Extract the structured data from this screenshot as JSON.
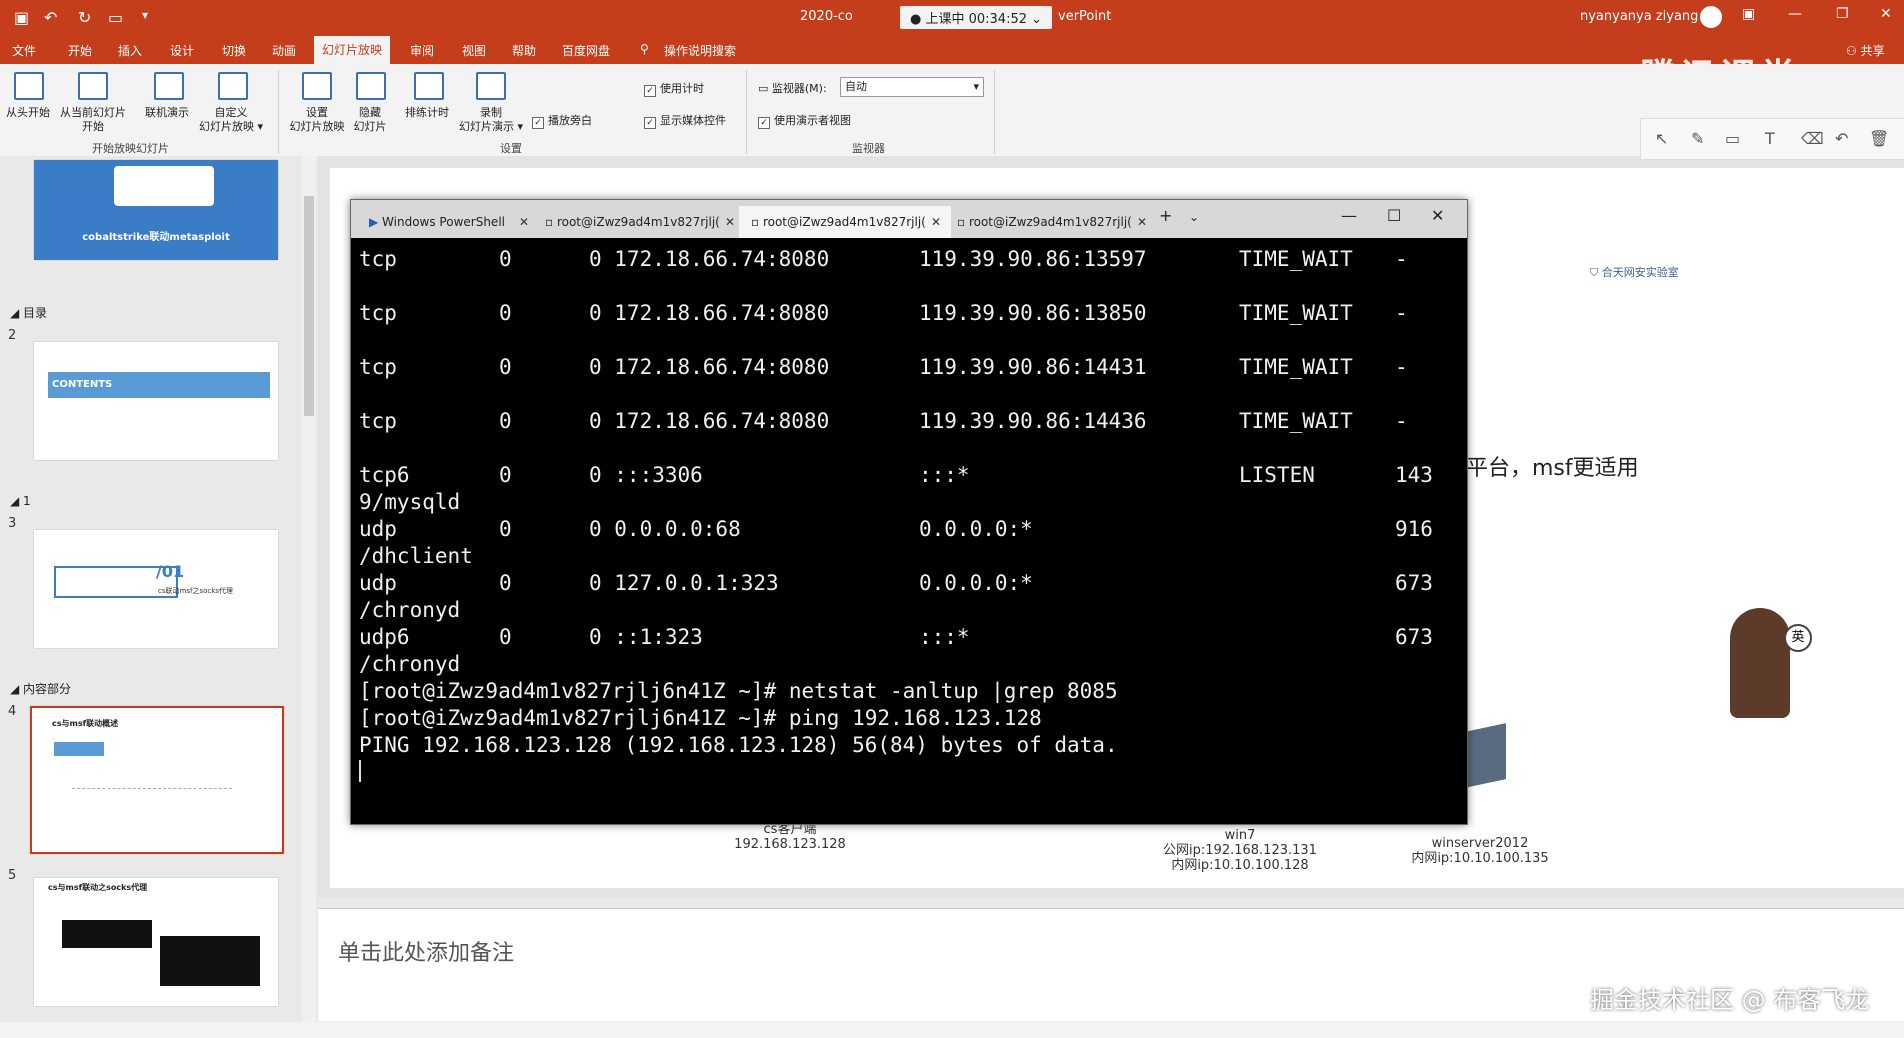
{
  "window": {
    "title_left": "2020-co",
    "title_right": "verPoint",
    "status": "上课中 00:34:52",
    "user": "nyanyanya ziyang"
  },
  "ribbon_tabs": [
    "文件",
    "开始",
    "插入",
    "设计",
    "切换",
    "动画",
    "幻灯片放映",
    "审阅",
    "视图",
    "帮助",
    "百度网盘",
    "操作说明搜索"
  ],
  "share": "共享",
  "brand": "腾讯课堂",
  "ribbon": {
    "btn1": "从头开始",
    "btn2a": "从当前幻灯片",
    "btn2b": "开始",
    "btn3": "联机演示",
    "btn4a": "自定义",
    "btn4b": "幻灯片放映",
    "group1": "开始放映幻灯片",
    "btn5a": "设置",
    "btn5b": "幻灯片放映",
    "btn6a": "隐藏",
    "btn6b": "幻灯片",
    "btn7": "排练计时",
    "btn8a": "录制",
    "btn8b": "幻灯片演示",
    "chk_narration": "播放旁白",
    "chk_timing": "使用计时",
    "chk_media": "显示媒体控件",
    "group2": "设置",
    "monitor_label": "监视器(M):",
    "monitor_value": "自动",
    "chk_presenter": "使用演示者视图",
    "group3": "监视器"
  },
  "left_panel": {
    "thumb1_title": "cobaltstrike联动metasploit",
    "section_toc": "目录",
    "num2": "2",
    "contents": "CONTENTS",
    "section_1": "1",
    "num3": "3",
    "slide3_title": "/01",
    "slide3_sub": "cs联动msf之socks代理",
    "section_content": "内容部分",
    "num4": "4",
    "slide4_title": "cs与msf联动概述",
    "num5": "5",
    "slide5_title": "cs与msf联动之socks代理"
  },
  "terminal": {
    "tabs": [
      {
        "label": "Windows PowerShell"
      },
      {
        "label": "root@iZwz9ad4m1v827rjlj("
      },
      {
        "label": "root@iZwz9ad4m1v827rjlj("
      },
      {
        "label": "root@iZwz9ad4m1v827rjlj("
      }
    ],
    "rows": [
      {
        "c1": "tcp",
        "c2": "0",
        "c3": "0 172.18.66.74:8080",
        "c4": "119.39.90.86:13597",
        "c5": "TIME_WAIT",
        "c6": "-"
      },
      {
        "c1": "tcp",
        "c2": "0",
        "c3": "0 172.18.66.74:8080",
        "c4": "119.39.90.86:13850",
        "c5": "TIME_WAIT",
        "c6": "-"
      },
      {
        "c1": "tcp",
        "c2": "0",
        "c3": "0 172.18.66.74:8080",
        "c4": "119.39.90.86:14431",
        "c5": "TIME_WAIT",
        "c6": "-"
      },
      {
        "c1": "tcp",
        "c2": "0",
        "c3": "0 172.18.66.74:8080",
        "c4": "119.39.90.86:14436",
        "c5": "TIME_WAIT",
        "c6": "-"
      },
      {
        "c1": "tcp6",
        "c2": "0",
        "c3": "0 :::3306",
        "c4": ":::*",
        "c5": "LISTEN",
        "c6": "143"
      },
      {
        "c1": "9/mysqld",
        "c2": "",
        "c3": "",
        "c4": "",
        "c5": "",
        "c6": ""
      },
      {
        "c1": "udp",
        "c2": "0",
        "c3": "0 0.0.0.0:68",
        "c4": "0.0.0.0:*",
        "c5": "",
        "c6": "916"
      },
      {
        "c1": "/dhclient",
        "c2": "",
        "c3": "",
        "c4": "",
        "c5": "",
        "c6": ""
      },
      {
        "c1": "udp",
        "c2": "0",
        "c3": "0 127.0.0.1:323",
        "c4": "0.0.0.0:*",
        "c5": "",
        "c6": "673"
      },
      {
        "c1": "/chronyd",
        "c2": "",
        "c3": "",
        "c4": "",
        "c5": "",
        "c6": ""
      },
      {
        "c1": "udp6",
        "c2": "0",
        "c3": "0 ::1:323",
        "c4": ":::*",
        "c5": "",
        "c6": "673"
      },
      {
        "c1": "/chronyd",
        "c2": "",
        "c3": "",
        "c4": "",
        "c5": "",
        "c6": ""
      }
    ],
    "cmd1": "[root@iZwz9ad4m1v827rjlj6n41Z ~]# netstat -anltup |grep 8085",
    "cmd2": "[root@iZwz9ad4m1v827rjlj6n41Z ~]# ping 192.168.123.128",
    "out1": "PING 192.168.123.128 (192.168.123.128) 56(84) bytes of data."
  },
  "slide": {
    "lab_logo": "合天网安实验室",
    "text_right": "平台，msf更适用",
    "client_label": "cs客户端",
    "client_ip": "192.168.123.128",
    "win7_label": "win7",
    "win7_public": "公网ip:192.168.123.131",
    "win7_internal": "内网ip:10.10.100.128",
    "ws_label": "winserver2012",
    "ws_internal": "内网ip:10.10.100.135",
    "sticker_badge": "英"
  },
  "notes_placeholder": "单击此处添加备注",
  "watermark": "掘金技术社区 @ 布客飞龙"
}
